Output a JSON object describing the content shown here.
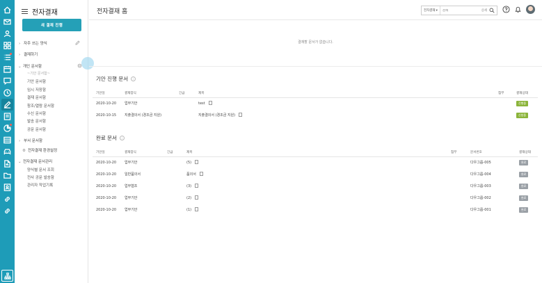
{
  "colors": {
    "rail": "#1e9cb8",
    "primary_button": "#25a0b7",
    "badge_progress": "#8bb43a",
    "badge_done": "#9aa0a6"
  },
  "rail_icons": [
    "home-icon",
    "mail-icon",
    "user-icon",
    "grid-icon",
    "list-icon",
    "calendar-icon",
    "chat-icon",
    "clock-icon",
    "approval-icon",
    "board-icon",
    "report-icon",
    "survey-icon",
    "car-icon",
    "document-icon",
    "folder-icon",
    "contact-icon",
    "link-icon",
    "link2-icon",
    "org-chart-icon"
  ],
  "sidebar": {
    "title": "전자결재",
    "new_button": "새 결재 진행",
    "frequent_forms": "자주 쓰는 양식",
    "approval_wait": "결재하기",
    "personal_box": "개인 문서함",
    "personal_note": "~기안 문서함~",
    "personal_items": [
      "기안 문서함",
      "임시 저장함",
      "결재 문서함",
      "참조/열람 문서함",
      "수신 문서함",
      "발송 문서함",
      "공문 문서함"
    ],
    "dept_box": "부서 문서함",
    "settings": "전자결재 환경설정",
    "admin": "전자결재 문서관리",
    "admin_items": [
      "양식별 문서 조회",
      "전사 공문 발송함",
      "관리자 작업기록"
    ]
  },
  "header": {
    "title": "전자결재 홈",
    "search_scope": "전자결재",
    "search_placeholder": "검색",
    "search_detail": "상세"
  },
  "empty_message": "결재할 문서가 없습니다.",
  "pending": {
    "title": "기안 진행 문서",
    "columns": [
      "기안일",
      "결재양식",
      "긴급",
      "제목",
      "첨부",
      "결재상태"
    ],
    "rows": [
      {
        "date": "2020-10-20",
        "form": "업무기안",
        "urgent": "",
        "subject": "test",
        "attach": "",
        "status": "진행중"
      },
      {
        "date": "2020-10-15",
        "form": "지출결의서 (경조금 지원)",
        "urgent": "",
        "subject": "지출결의서 (경조금 지원)",
        "attach": "",
        "status": "신청중"
      }
    ]
  },
  "completed": {
    "title": "완료 문서",
    "columns": [
      "기안일",
      "결재양식",
      "긴급",
      "제목",
      "첨부",
      "문서번호",
      "결재상태"
    ],
    "rows": [
      {
        "date": "2020-10-20",
        "form": "업무기안",
        "urgent": "",
        "subject": "(5)",
        "attach": "",
        "docno": "다우그룹-005",
        "status": "완료"
      },
      {
        "date": "2020-10-20",
        "form": "일반품의서",
        "urgent": "",
        "subject": "품의서",
        "attach": "",
        "docno": "다우그룹-004",
        "status": "완료"
      },
      {
        "date": "2020-10-20",
        "form": "업무협조",
        "urgent": "",
        "subject": "(3)",
        "attach": "",
        "docno": "다우그룹-003",
        "status": "완료"
      },
      {
        "date": "2020-10-20",
        "form": "업무기안",
        "urgent": "",
        "subject": "(2)",
        "attach": "",
        "docno": "다우그룹-002",
        "status": "완료"
      },
      {
        "date": "2020-10-20",
        "form": "업무기안",
        "urgent": "",
        "subject": "(1)",
        "attach": "",
        "docno": "다우그룹-001",
        "status": "완료"
      }
    ]
  }
}
